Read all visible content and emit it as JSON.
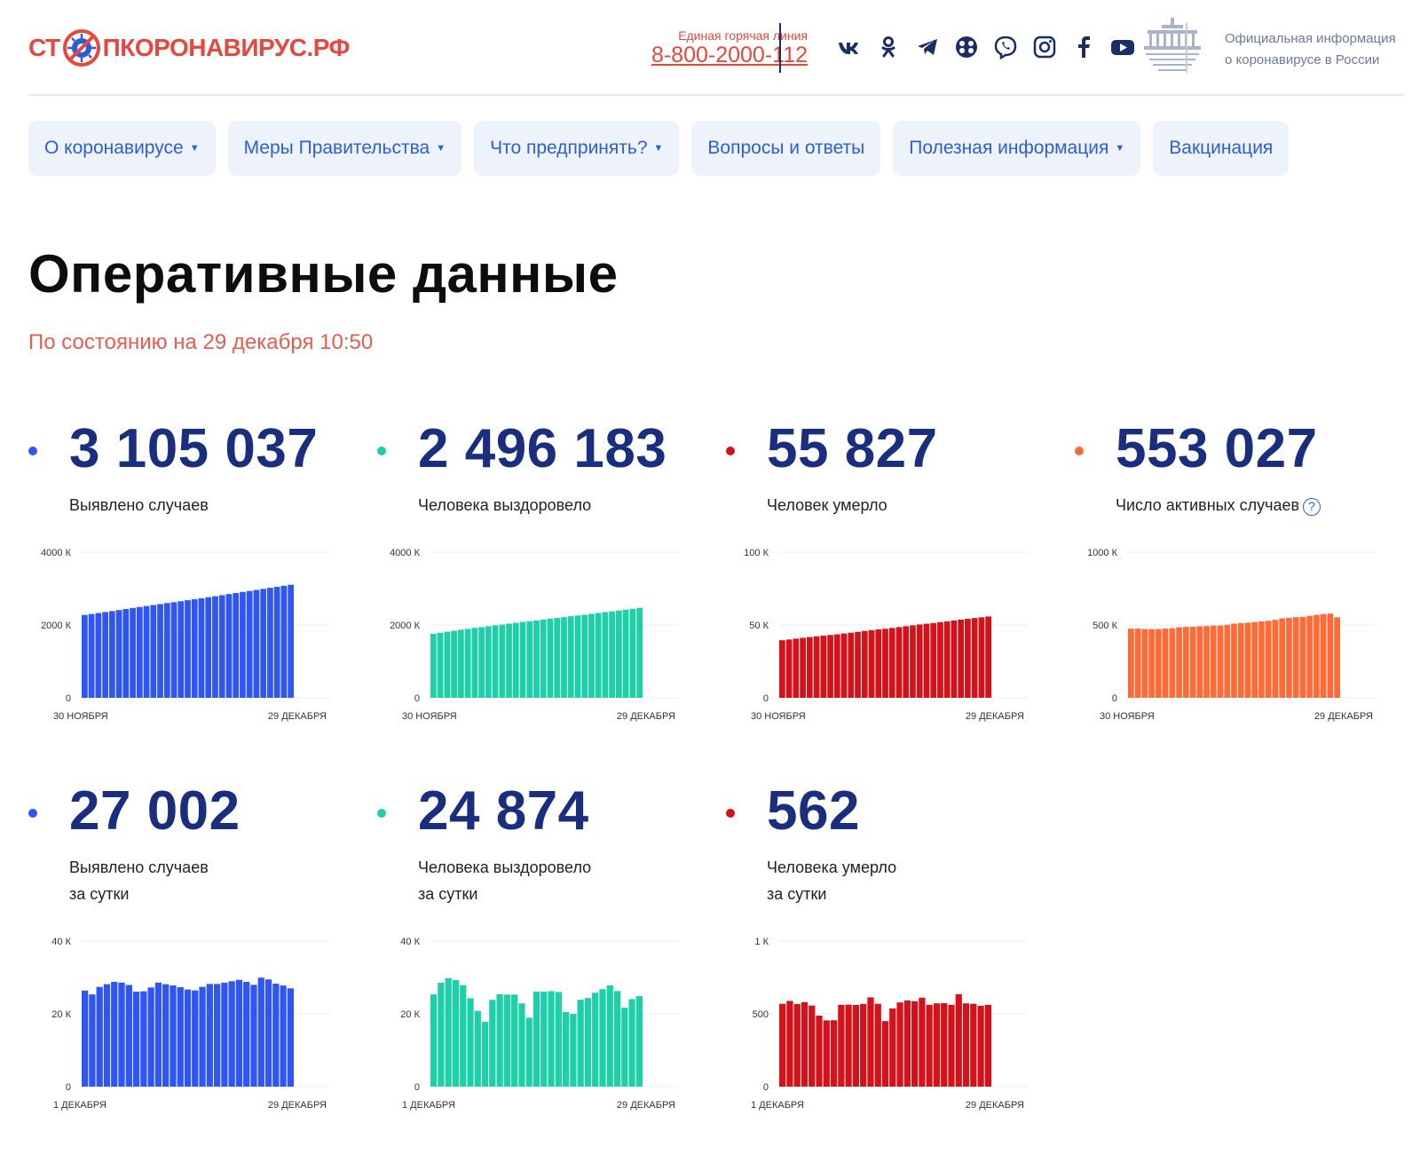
{
  "header": {
    "logo": {
      "part1": "СТ",
      "part2": "ПКОРОНАВИРУС.РФ"
    },
    "hotline_label": "Единая горячая линия",
    "hotline_number": "8-800-2000-112",
    "social_icons": [
      "vk-icon",
      "odnoklassniki-icon",
      "telegram-icon",
      "yandex-zen-icon",
      "viber-icon",
      "instagram-icon",
      "facebook-icon",
      "youtube-icon"
    ],
    "gov_text_line1": "Официальная информация",
    "gov_text_line2": "о коронавирусе в России"
  },
  "nav": [
    {
      "label": "О коронавирусе",
      "dropdown": true
    },
    {
      "label": "Меры Правительства",
      "dropdown": true
    },
    {
      "label": "Что предпринять?",
      "dropdown": true
    },
    {
      "label": "Вопросы и ответы",
      "dropdown": false
    },
    {
      "label": "Полезная информация",
      "dropdown": true
    },
    {
      "label": "Вакцинация",
      "dropdown": false
    }
  ],
  "page": {
    "title": "Оперативные данные",
    "subtitle": "По состоянию на 29 декабря 10:50"
  },
  "stats": [
    {
      "value": "3 105 037",
      "label_line1": "Выявлено случаев",
      "label_line2": "",
      "color": "#2f55f2",
      "help": false
    },
    {
      "value": "2 496 183",
      "label_line1": "Человека выздоровело",
      "label_line2": "",
      "color": "#1dd0a8",
      "help": false
    },
    {
      "value": "55 827",
      "label_line1": "Человек умерло",
      "label_line2": "",
      "color": "#d4121b",
      "help": false
    },
    {
      "value": "553 027",
      "label_line1": "Число активных случаев",
      "label_line2": "",
      "color": "#ff6a36",
      "help": true
    },
    {
      "value": "27 002",
      "label_line1": "Выявлено случаев",
      "label_line2": "за сутки",
      "color": "#2f55f2",
      "help": false
    },
    {
      "value": "24 874",
      "label_line1": "Человека выздоровело",
      "label_line2": "за сутки",
      "color": "#1dd0a8",
      "help": false
    },
    {
      "value": "562",
      "label_line1": "Человека умерло",
      "label_line2": "за сутки",
      "color": "#d4121b",
      "help": false
    }
  ],
  "chart_data": [
    {
      "type": "bar",
      "title": "Выявлено случаев",
      "x_start_label": "30 НОЯБРЯ",
      "x_end_label": "29 ДЕКАБРЯ",
      "y_ticks": [
        "4000 К",
        "2000 К",
        "0"
      ],
      "ylim": [
        0,
        4000000
      ],
      "color": "#2f55f2",
      "values": [
        2275936,
        2302062,
        2328345,
        2354934,
        2382012,
        2410462,
        2439163,
        2468068,
        2495577,
        2521745,
        2548139,
        2574980,
        2602880,
        2625848,
        2653936,
        2680939,
        2707946,
        2735142,
        2762668,
        2790366,
        2819429,
        2848377,
        2877727,
        2906503,
        2935331,
        2963173,
        2992706,
        3021964,
        3050248,
        3078035,
        3105037
      ]
    },
    {
      "type": "bar",
      "title": "Человека выздоровело",
      "x_start_label": "30 НОЯБРЯ",
      "x_end_label": "29 ДЕКАБРЯ",
      "y_ticks": [
        "4000 К",
        "2000 К",
        "0"
      ],
      "ylim": [
        0,
        4000000
      ],
      "color": "#1dd0a8",
      "values": [
        1761457,
        1786807,
        1815346,
        1842461,
        1867816,
        1893003,
        1918962,
        1940981,
        1964824,
        1989244,
        2011922,
        2037023,
        2060734,
        2083598,
        2104942,
        2124019,
        2147238,
        2170495,
        2193698,
        2216049,
        2240221,
        2261913,
        2280362,
        2304829,
        2329164,
        2354285,
        2375946,
        2398415,
        2420418,
        2444467,
        2471309
      ]
    },
    {
      "type": "bar",
      "title": "Человек умерло",
      "x_start_label": "30 НОЯБРЯ",
      "x_end_label": "29 ДЕКАБРЯ",
      "y_ticks": [
        "100 К",
        "50 К",
        "0"
      ],
      "ylim": [
        0,
        100000
      ],
      "color": "#d4121b",
      "values": [
        39527,
        40050,
        40630,
        41173,
        41730,
        42176,
        42684,
        43141,
        43597,
        44159,
        44718,
        45280,
        45893,
        46453,
        46941,
        47391,
        47968,
        48564,
        49151,
        49762,
        50347,
        50858,
        51351,
        51912,
        52461,
        53096,
        53659,
        54226,
        54778,
        55265,
        55827
      ]
    },
    {
      "type": "bar",
      "title": "Число активных случаев",
      "x_start_label": "30 НОЯБРЯ",
      "x_end_label": "29 ДЕКАБРЯ",
      "y_ticks": [
        "1000 К",
        "500 К",
        "0"
      ],
      "ylim": [
        0,
        1000000
      ],
      "color": "#ff6a36",
      "values": [
        474952,
        475205,
        472369,
        471300,
        472466,
        475283,
        477517,
        483946,
        487156,
        488342,
        491499,
        492677,
        496253,
        495797,
        502053,
        509529,
        512740,
        516083,
        519819,
        524555,
        528861,
        535606,
        546014,
        549762,
        553706,
        555792,
        563101,
        569323,
        575052,
        578303,
        553027
      ]
    },
    {
      "type": "bar",
      "title": "Выявлено случаев за сутки",
      "x_start_label": "1 ДЕКАБРЯ",
      "x_end_label": "29 ДЕКАБРЯ",
      "y_ticks": [
        "40 К",
        "20 К",
        "0"
      ],
      "ylim": [
        0,
        40000
      ],
      "color": "#2f55f2",
      "values": [
        26402,
        25345,
        27403,
        28145,
        28782,
        28585,
        27927,
        26097,
        26190,
        27250,
        28585,
        28137,
        27787,
        27328,
        26689,
        26431,
        27408,
        28214,
        28209,
        28552,
        28948,
        29350,
        28776,
        27982,
        29935,
        29453,
        28284,
        27787,
        27002
      ]
    },
    {
      "type": "bar",
      "title": "Человека выздоровело за сутки",
      "x_start_label": "1 ДЕКАБРЯ",
      "x_end_label": "29 ДЕКАБРЯ",
      "y_ticks": [
        "40 К",
        "20 К",
        "0"
      ],
      "ylim": [
        0,
        40000
      ],
      "color": "#1dd0a8",
      "values": [
        25350,
        28539,
        29815,
        29300,
        27876,
        24280,
        20813,
        17813,
        23847,
        25370,
        25287,
        25287,
        22878,
        18934,
        26089,
        26092,
        26235,
        26006,
        20519,
        20012,
        23860,
        24339,
        25803,
        26773,
        27816,
        26262,
        21661,
        24048,
        24874
      ]
    },
    {
      "type": "bar",
      "title": "Человека умерло за сутки",
      "x_start_label": "1 ДЕКАБРЯ",
      "x_end_label": "29 ДЕКАБРЯ",
      "y_ticks": [
        "1 К",
        "500",
        "0"
      ],
      "ylim": [
        0,
        1000
      ],
      "color": "#d4121b",
      "values": [
        569,
        589,
        567,
        580,
        557,
        488,
        455,
        456,
        562,
        563,
        561,
        568,
        613,
        569,
        450,
        537,
        578,
        592,
        587,
        611,
        562,
        572,
        573,
        562,
        635,
        572,
        569,
        555,
        562
      ]
    }
  ]
}
